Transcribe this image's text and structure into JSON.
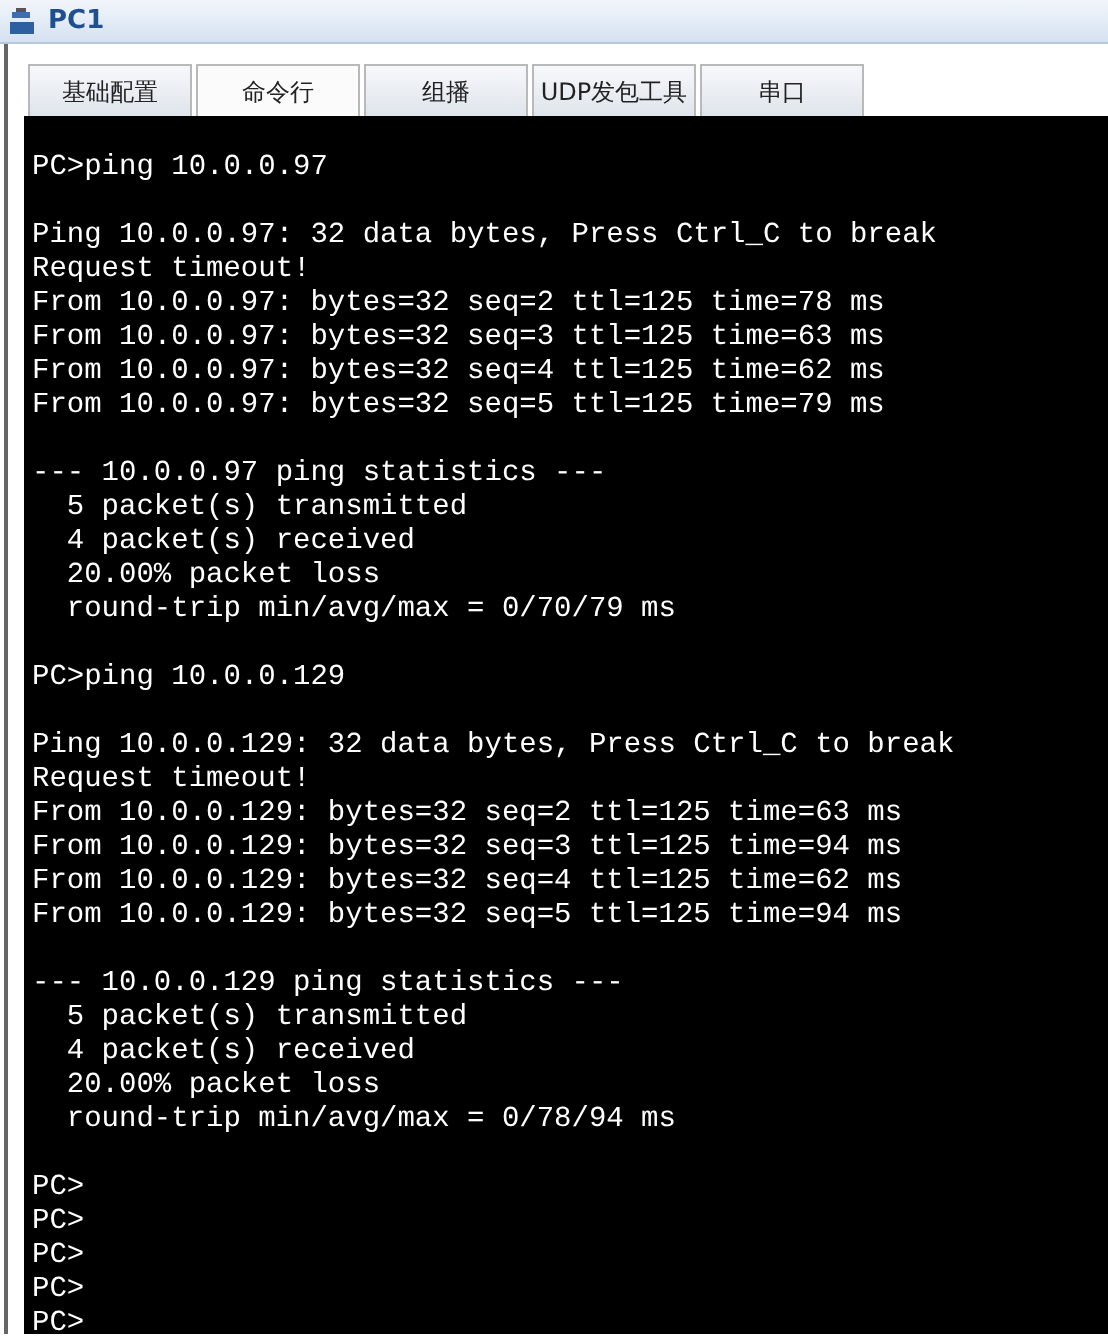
{
  "window": {
    "title": "PC1"
  },
  "tabs": [
    {
      "label": "基础配置",
      "selected": false
    },
    {
      "label": "命令行",
      "selected": true
    },
    {
      "label": "组播",
      "selected": false
    },
    {
      "label": "UDP发包工具",
      "selected": false
    },
    {
      "label": "串口",
      "selected": false
    }
  ],
  "terminal": {
    "blocks": [
      [
        "PC>ping 10.0.0.97"
      ],
      [
        "Ping 10.0.0.97: 32 data bytes, Press Ctrl_C to break",
        "Request timeout!",
        "From 10.0.0.97: bytes=32 seq=2 ttl=125 time=78 ms",
        "From 10.0.0.97: bytes=32 seq=3 ttl=125 time=63 ms",
        "From 10.0.0.97: bytes=32 seq=4 ttl=125 time=62 ms",
        "From 10.0.0.97: bytes=32 seq=5 ttl=125 time=79 ms"
      ],
      [
        "--- 10.0.0.97 ping statistics ---",
        "  5 packet(s) transmitted",
        "  4 packet(s) received",
        "  20.00% packet loss",
        "  round-trip min/avg/max = 0/70/79 ms"
      ],
      [
        "PC>ping 10.0.0.129"
      ],
      [
        "Ping 10.0.0.129: 32 data bytes, Press Ctrl_C to break",
        "Request timeout!",
        "From 10.0.0.129: bytes=32 seq=2 ttl=125 time=63 ms",
        "From 10.0.0.129: bytes=32 seq=3 ttl=125 time=94 ms",
        "From 10.0.0.129: bytes=32 seq=4 ttl=125 time=62 ms",
        "From 10.0.0.129: bytes=32 seq=5 ttl=125 time=94 ms"
      ],
      [
        "--- 10.0.0.129 ping statistics ---",
        "  5 packet(s) transmitted",
        "  4 packet(s) received",
        "  20.00% packet loss",
        "  round-trip min/avg/max = 0/78/94 ms"
      ],
      [
        "PC>",
        "PC>",
        "PC>",
        "PC>",
        "PC>"
      ]
    ]
  }
}
